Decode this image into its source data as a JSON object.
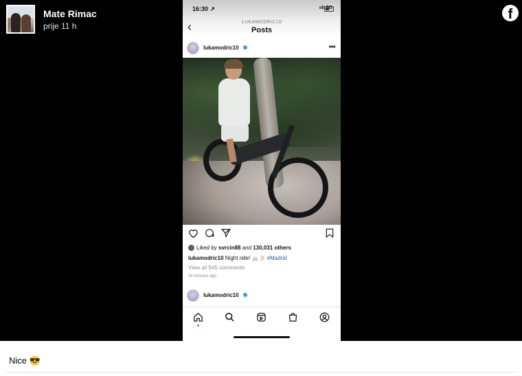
{
  "facebook": {
    "author_name": "Mate Rimac",
    "timestamp": "prije 11 h",
    "caption": "Nice 😎",
    "logo": "facebook-logo",
    "colors": {
      "background": "#000000",
      "text": "#ffffff"
    }
  },
  "phone": {
    "status_time": "16:30 ↗",
    "signal": "5G",
    "nav_username": "LUKAMODRIC10",
    "nav_title": "Posts",
    "post": {
      "username": "lukamodric10",
      "liked_by_prefix": "Liked by ",
      "liked_by_user": "svrcin88",
      "liked_by_suffix": " and ",
      "liked_by_count": "130,031 others",
      "caption_user": "lukamodric10",
      "caption_text": " Night ride! 🚲👌🏻 ",
      "caption_tag": "#Madrid",
      "comments_link": "View all 845 comments",
      "age": "26 minutes ago"
    },
    "next_post": {
      "username": "lukamodric10"
    },
    "colors": {
      "verified": "#3897f0",
      "hashtag": "#2a5db0",
      "notification_dot": "#ed4956"
    }
  }
}
